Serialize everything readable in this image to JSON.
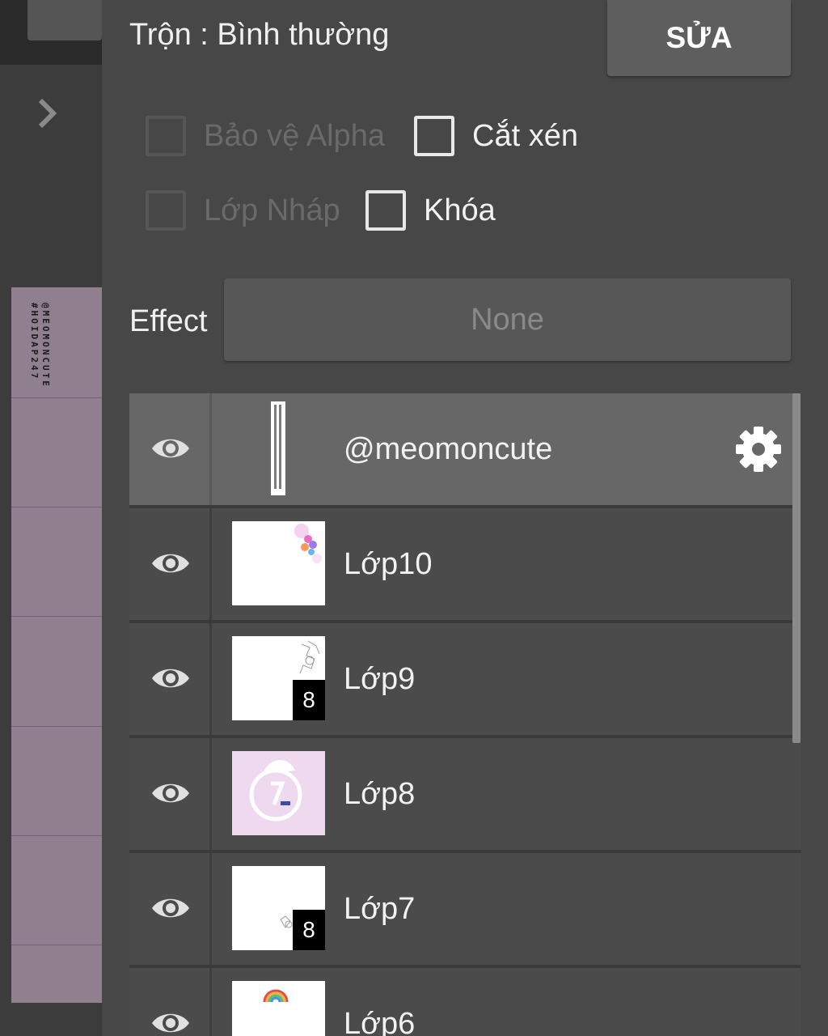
{
  "header": {
    "blend_mode_label": "Trộn : Bình thường",
    "edit_button_label": "SỬA"
  },
  "options": {
    "protect_alpha": {
      "label": "Bảo vệ Alpha",
      "checked": false,
      "enabled": false
    },
    "clipping": {
      "label": "Cắt xén",
      "checked": false,
      "enabled": true
    },
    "draft_layer": {
      "label": "Lớp Nháp",
      "checked": false,
      "enabled": false
    },
    "lock": {
      "label": "Khóa",
      "checked": false,
      "enabled": true
    }
  },
  "effect": {
    "label": "Effect",
    "value": "None"
  },
  "canvas_preview": {
    "watermark_lines": [
      "@MEOMONCUTE",
      "#HOIDAP247"
    ]
  },
  "layers": [
    {
      "name": "@meomoncute",
      "selected": true,
      "visible": true,
      "badge": ""
    },
    {
      "name": "Lớp10",
      "selected": false,
      "visible": true,
      "badge": ""
    },
    {
      "name": "Lớp9",
      "selected": false,
      "visible": true,
      "badge": "8"
    },
    {
      "name": "Lớp8",
      "selected": false,
      "visible": true,
      "badge": ""
    },
    {
      "name": "Lớp7",
      "selected": false,
      "visible": true,
      "badge": "8"
    },
    {
      "name": "Lớp6",
      "selected": false,
      "visible": true,
      "badge": ""
    }
  ],
  "icons": {
    "expand": "chevron-right-icon",
    "visibility": "eye-icon",
    "layer_settings": "gear-icon"
  }
}
